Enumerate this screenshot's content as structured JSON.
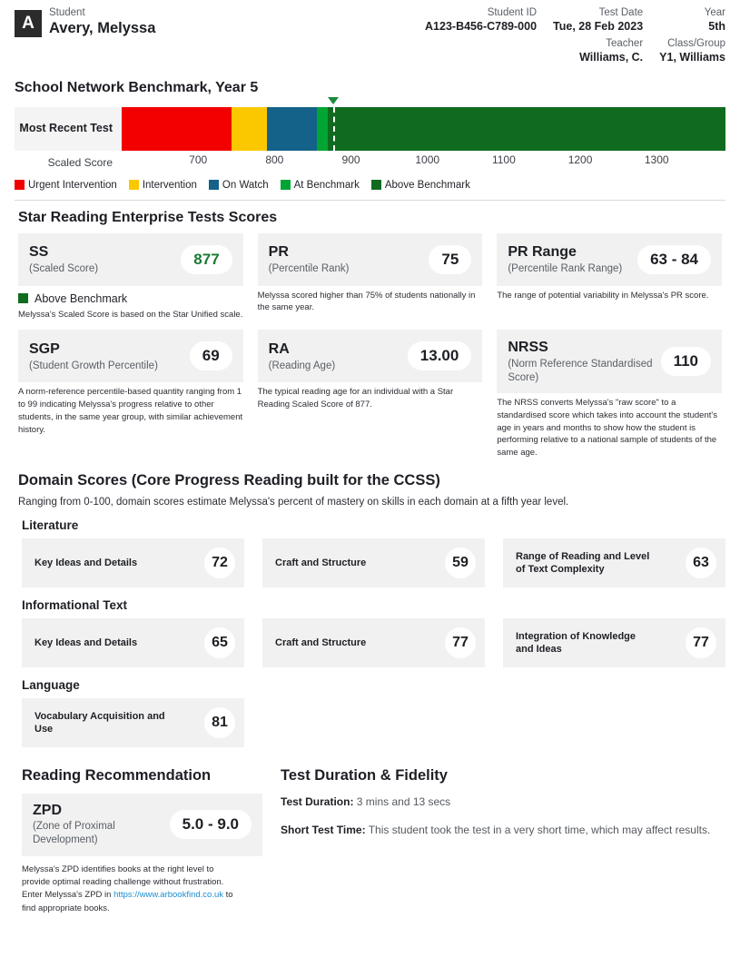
{
  "header": {
    "avatar_initial": "A",
    "student_caption": "Student",
    "student_name": "Avery, Melyssa",
    "fields": {
      "student_id_label": "Student ID",
      "student_id_value": "A123-B456-C789-000",
      "test_date_label": "Test Date",
      "test_date_value": "Tue, 28 Feb 2023",
      "year_label": "Year",
      "year_value": "5th",
      "teacher_label": "Teacher",
      "teacher_value": "Williams, C.",
      "class_label": "Class/Group",
      "class_value": "Y1, Williams"
    }
  },
  "benchmark": {
    "title": "School Network Benchmark, Year 5",
    "row_label": "Most Recent Test",
    "axis_label": "Scaled Score",
    "axis_ticks": [
      "700",
      "800",
      "900",
      "1000",
      "1100",
      "1200",
      "1300"
    ],
    "student_score": 877,
    "legend": [
      {
        "label": "Urgent Intervention",
        "color": "#f20000"
      },
      {
        "label": "Intervention",
        "color": "#fbc800"
      },
      {
        "label": "On Watch",
        "color": "#146289"
      },
      {
        "label": "At Benchmark",
        "color": "#00a533"
      },
      {
        "label": "Above Benchmark",
        "color": "#106b1f"
      }
    ]
  },
  "chart_data": {
    "type": "bar",
    "title": "School Network Benchmark, Year 5",
    "xlabel": "Scaled Score",
    "ylabel": "",
    "xlim": [
      600,
      1390
    ],
    "ticks": [
      700,
      800,
      900,
      1000,
      1100,
      1200,
      1300
    ],
    "grid": false,
    "legend_position": "bottom",
    "marker": {
      "label": "Most Recent Test",
      "value": 877
    },
    "series": [
      {
        "name": "Urgent Intervention",
        "range": [
          600,
          744
        ],
        "color": "#f20000"
      },
      {
        "name": "Intervention",
        "range": [
          744,
          790
        ],
        "color": "#fbc800"
      },
      {
        "name": "On Watch",
        "range": [
          790,
          855
        ],
        "color": "#146289"
      },
      {
        "name": "At Benchmark",
        "range": [
          855,
          870
        ],
        "color": "#00a533"
      },
      {
        "name": "Above Benchmark",
        "range": [
          870,
          1390
        ],
        "color": "#106b1f"
      }
    ]
  },
  "scores_section": {
    "title": "Star Reading Enterprise Tests Scores",
    "cards": [
      {
        "abbr": "SS",
        "sub": "(Scaled Score)",
        "value": "877",
        "value_accent": true,
        "benchmark_label": "Above Benchmark",
        "benchmark_color": "#106b1f",
        "note": "Melyssa's Scaled Score is based on the Star Unified scale."
      },
      {
        "abbr": "PR",
        "sub": "(Percentile Rank)",
        "value": "75",
        "note": "Melyssa scored higher than 75% of students nationally in the same year."
      },
      {
        "abbr": "PR Range",
        "sub": "(Percentile Rank Range)",
        "value": "63 - 84",
        "note": "The range of potential variability in Melyssa's PR score."
      },
      {
        "abbr": "SGP",
        "sub": "(Student Growth Percentile)",
        "value": "69",
        "note": "A norm-reference percentile-based quantity ranging from 1 to 99 indicating Melyssa's progress relative to other students, in the same year group, with similar achievement history."
      },
      {
        "abbr": "RA",
        "sub": "(Reading Age)",
        "value": "13.00",
        "note": "The typical reading age for an individual with a Star Reading Scaled Score of 877."
      },
      {
        "abbr": "NRSS",
        "sub": "(Norm Reference Standardised Score)",
        "value": "110",
        "note": "The NRSS converts Melyssa's \"raw score\" to a standardised score which takes into account the student's age in years and months to show how the student is performing relative to a national sample of students of the same age."
      }
    ]
  },
  "domain_scores": {
    "title": "Domain Scores (Core Progress Reading built for the CCSS)",
    "description": "Ranging from 0-100, domain scores estimate Melyssa's percent of mastery on skills in each domain at a fifth year level.",
    "groups": [
      {
        "name": "Literature",
        "items": [
          {
            "name": "Key Ideas and Details",
            "score": "72"
          },
          {
            "name": "Craft and Structure",
            "score": "59"
          },
          {
            "name": "Range of Reading and Level of Text Complexity",
            "score": "63"
          }
        ]
      },
      {
        "name": "Informational Text",
        "items": [
          {
            "name": "Key Ideas and Details",
            "score": "65"
          },
          {
            "name": "Craft and Structure",
            "score": "77"
          },
          {
            "name": "Integration of Knowledge and Ideas",
            "score": "77"
          }
        ]
      },
      {
        "name": "Language",
        "items": [
          {
            "name": "Vocabulary Acquisition and Use",
            "score": "81"
          }
        ]
      }
    ]
  },
  "reading_recommendation": {
    "title": "Reading Recommendation",
    "abbr": "ZPD",
    "sub": "(Zone of Proximal Development)",
    "value": "5.0 - 9.0",
    "note_part1": "Melyssa's ZPD identifies books at the right level to provide optimal reading challenge without frustration. Enter Melyssa's ZPD in ",
    "note_link": "https://www.arbookfind.co.uk",
    "note_part2": " to find appropriate books."
  },
  "test_duration": {
    "title": "Test Duration & Fidelity",
    "duration_label": "Test Duration:",
    "duration_value": "3 mins and 13 secs",
    "fidelity_label": "Short Test Time:",
    "fidelity_value": "This student took the test in a very short time, which may affect results."
  }
}
